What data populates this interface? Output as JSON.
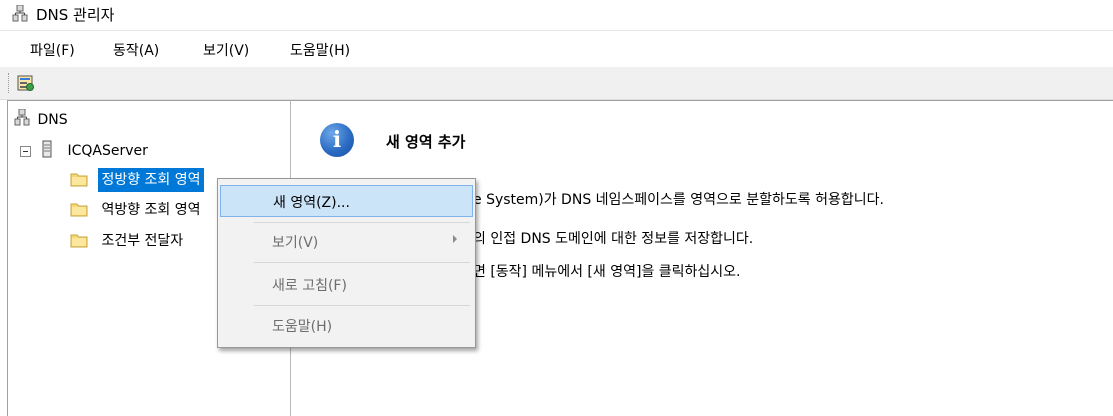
{
  "window": {
    "title": "DNS 관리자",
    "icon": "dns-manager-icon"
  },
  "menubar": {
    "items": [
      {
        "label": "파일(F)"
      },
      {
        "label": "동작(A)"
      },
      {
        "label": "보기(V)"
      },
      {
        "label": "도움말(H)"
      }
    ]
  },
  "toolbar": {
    "buttons": [
      {
        "icon": "properties-icon"
      }
    ]
  },
  "tree": {
    "root": "DNS",
    "server": "ICQAServer",
    "nodes": [
      {
        "label": "정방향 조회 영역",
        "selected": true
      },
      {
        "label": "역방향 조회 영역",
        "selected": false
      },
      {
        "label": "조건부 전달자",
        "selected": false
      }
    ]
  },
  "info": {
    "title": "새 영역 추가",
    "lines": [
      "e System)가 DNS 네임스페이스를 영역으로 분할하도록 허용합니다.",
      "의 인접 DNS 도메인에 대한 정보를 저장합니다.",
      "면 [동작] 메뉴에서 [새 영역]을 클릭하십시오."
    ]
  },
  "context_menu": {
    "items": [
      {
        "label": "새 영역(Z)...",
        "highlighted": true,
        "enabled": true
      },
      {
        "label": "보기(V)",
        "enabled": false,
        "submenu": true
      },
      {
        "label": "새로 고침(F)",
        "enabled": false
      },
      {
        "label": "도움말(H)",
        "enabled": false
      }
    ]
  },
  "colors": {
    "selection": "#0078d7",
    "menu_highlight": "#cce4f7"
  }
}
